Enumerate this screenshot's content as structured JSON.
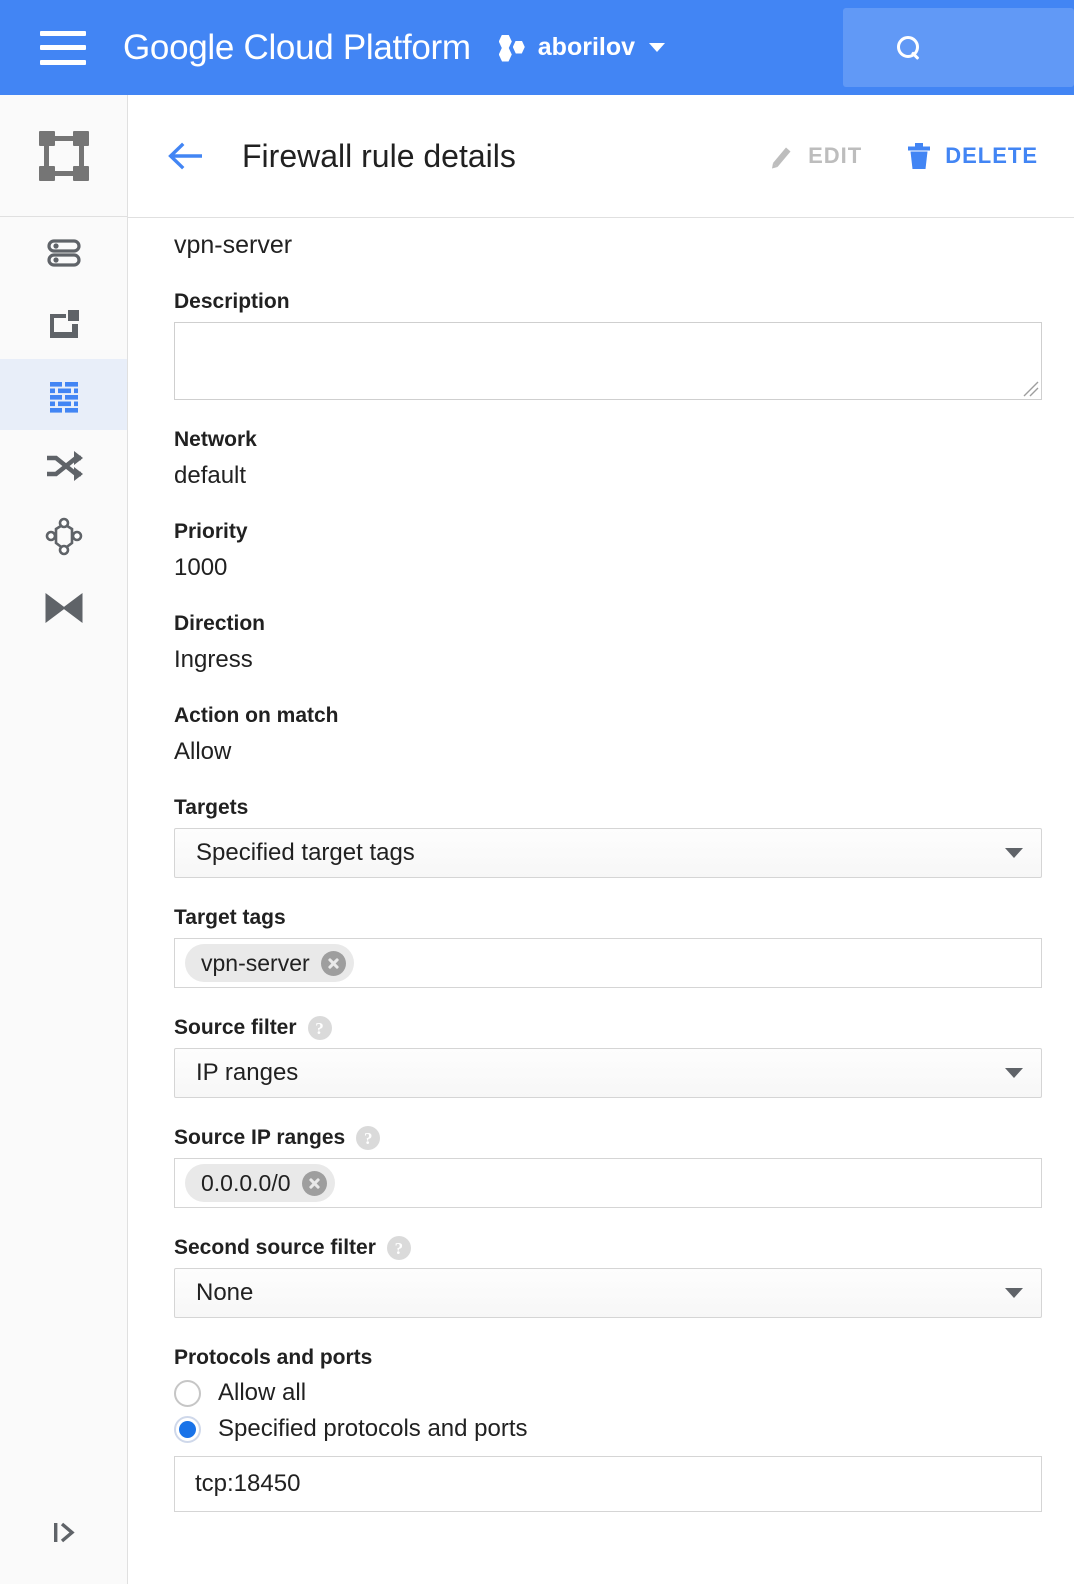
{
  "header": {
    "menu_icon": "hamburger-menu-icon",
    "brand": "Google Cloud Platform",
    "project_icon": "project-selector-icon",
    "project_name": "aborilov",
    "project_caret": "chevron-down-icon",
    "search_icon": "search-icon",
    "search_value": "",
    "search_placeholder": "",
    "bg_color": "#4285f4"
  },
  "sidebar": {
    "logo_icon": "vpc-network-icon",
    "collapse_icon": "expand-panel-icon",
    "active_color": "#4285f4",
    "active_bg": "#e8eef9",
    "items": [
      {
        "icon": "vpc-networks-icon",
        "name": "sidebar-item-vpc-networks",
        "active": false
      },
      {
        "icon": "external-ip-addresses-icon",
        "name": "sidebar-item-external-ip-addresses",
        "active": false
      },
      {
        "icon": "firewall-rules-icon",
        "name": "sidebar-item-firewall-rules",
        "active": true
      },
      {
        "icon": "routes-icon",
        "name": "sidebar-item-routes",
        "active": false
      },
      {
        "icon": "vpc-network-peering-icon",
        "name": "sidebar-item-vpc-network-peering",
        "active": false
      },
      {
        "icon": "shared-vpc-icon",
        "name": "sidebar-item-shared-vpc",
        "active": false
      }
    ]
  },
  "page": {
    "back_icon": "back-arrow-icon",
    "title": "Firewall rule details",
    "actions": {
      "edit_icon": "pencil-icon",
      "edit_label": "EDIT",
      "edit_disabled": true,
      "delete_icon": "trash-icon",
      "delete_label": "DELETE",
      "delete_color": "#4285f4"
    }
  },
  "form": {
    "rule_name": "vpn-server",
    "description_label": "Description",
    "description_value": "",
    "network_label": "Network",
    "network_value": "default",
    "priority_label": "Priority",
    "priority_value": "1000",
    "direction_label": "Direction",
    "direction_value": "Ingress",
    "action_label": "Action on match",
    "action_value": "Allow",
    "targets_label": "Targets",
    "targets_value": "Specified target tags",
    "target_tags_label": "Target tags",
    "target_tags_chip": "vpn-server",
    "source_filter_label": "Source filter",
    "source_filter_help": "help-icon",
    "source_filter_value": "IP ranges",
    "source_ip_label": "Source IP ranges",
    "source_ip_help": "help-icon",
    "source_ip_chip": "0.0.0.0/0",
    "second_filter_label": "Second source filter",
    "second_filter_help": "help-icon",
    "second_filter_value": "None",
    "protocols_label": "Protocols and ports",
    "protocol_allow_all": "Allow all",
    "protocol_specified": "Specified protocols and ports",
    "protocol_selected": "specified",
    "ports_value": "tcp:18450"
  }
}
